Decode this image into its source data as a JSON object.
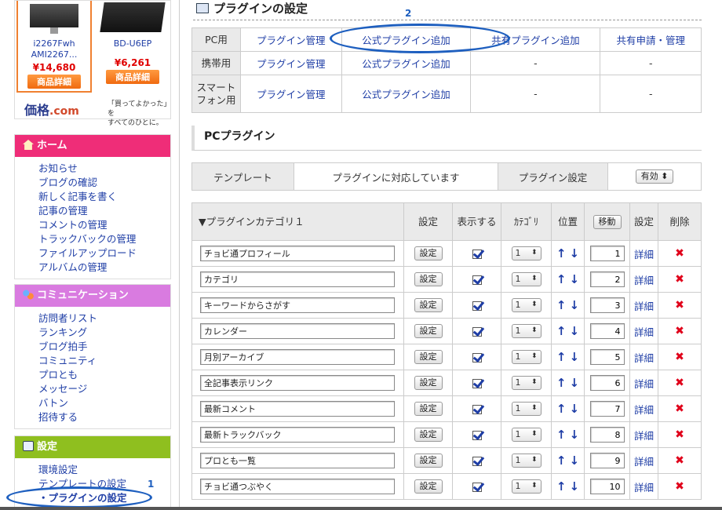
{
  "ads": {
    "products": [
      {
        "name": "i2267Fwh AMI2267...",
        "price": "¥14,680",
        "button": "商品詳細"
      },
      {
        "name": "BD-U6EP",
        "price": "¥6,261",
        "button": "商品詳細"
      }
    ],
    "logo_main": "価格",
    "logo_com": ".com",
    "tagline_1": "「買ってよかった」を",
    "tagline_2": "すべてのひとに。"
  },
  "sidebar": {
    "home": {
      "title": "ホーム",
      "items": [
        "お知らせ",
        "ブログの確認",
        "新しく記事を書く",
        "記事の管理",
        "コメントの管理",
        "トラックバックの管理",
        "ファイルアップロード",
        "アルバムの管理"
      ]
    },
    "community": {
      "title": "コミュニケーション",
      "items": [
        "訪問者リスト",
        "ランキング",
        "ブログ拍手",
        "コミュニティ",
        "プロとも",
        "メッセージ",
        "バトン",
        "招待する"
      ]
    },
    "settings": {
      "title": "設定",
      "items": [
        "環境設定",
        "テンプレートの設定",
        "・プラグインの設定"
      ]
    }
  },
  "annotations": {
    "num1": "1",
    "num2": "2"
  },
  "page": {
    "title": "プラグインの設定"
  },
  "plugin_menu": {
    "rows": [
      {
        "label": "PC用",
        "cells": [
          "プラグイン管理",
          "公式プラグイン追加",
          "共有プラグイン追加",
          "共有申請・管理"
        ]
      },
      {
        "label": "携帯用",
        "cells": [
          "プラグイン管理",
          "公式プラグイン追加",
          "-",
          "-"
        ]
      },
      {
        "label": "スマートフォン用",
        "cells": [
          "プラグイン管理",
          "公式プラグイン追加",
          "-",
          "-"
        ]
      }
    ]
  },
  "pc_section": {
    "title": "PCプラグイン"
  },
  "template_row": {
    "label": "テンプレート",
    "status": "プラグインに対応しています",
    "setting_label": "プラグイン設定",
    "setting_value": "有効 ⬍"
  },
  "plugin_table": {
    "headers": {
      "category": "▼プラグインカテゴリ１",
      "settings": "設定",
      "display": "表示する",
      "category_col": "ｶﾃｺﾞﾘ",
      "position": "位置",
      "move": "移動",
      "settings2": "設定",
      "delete": "削除"
    },
    "settings_btn": "設定",
    "detail_label": "詳細",
    "up_arrow": "↑",
    "down_arrow": "↓",
    "delete_icon": "✖",
    "rows": [
      {
        "name": "チョビ通プロフィール",
        "category": "1",
        "position": "1"
      },
      {
        "name": "カテゴリ",
        "category": "1",
        "position": "2"
      },
      {
        "name": "キーワードからさがす",
        "category": "1",
        "position": "3"
      },
      {
        "name": "カレンダー",
        "category": "1",
        "position": "4"
      },
      {
        "name": "月別アーカイブ",
        "category": "1",
        "position": "5"
      },
      {
        "name": "全記事表示リンク",
        "category": "1",
        "position": "6"
      },
      {
        "name": "最新コメント",
        "category": "1",
        "position": "7"
      },
      {
        "name": "最新トラックバック",
        "category": "1",
        "position": "8"
      },
      {
        "name": "プロとも一覧",
        "category": "1",
        "position": "9"
      },
      {
        "name": "チョビ通つぶやく",
        "category": "1",
        "position": "10"
      }
    ]
  },
  "colors": {
    "home": "#ef2d78",
    "community": "#d97be0",
    "settings": "#8fbf1f",
    "annotation": "#1e5fbf",
    "link": "#1f3ea6"
  }
}
